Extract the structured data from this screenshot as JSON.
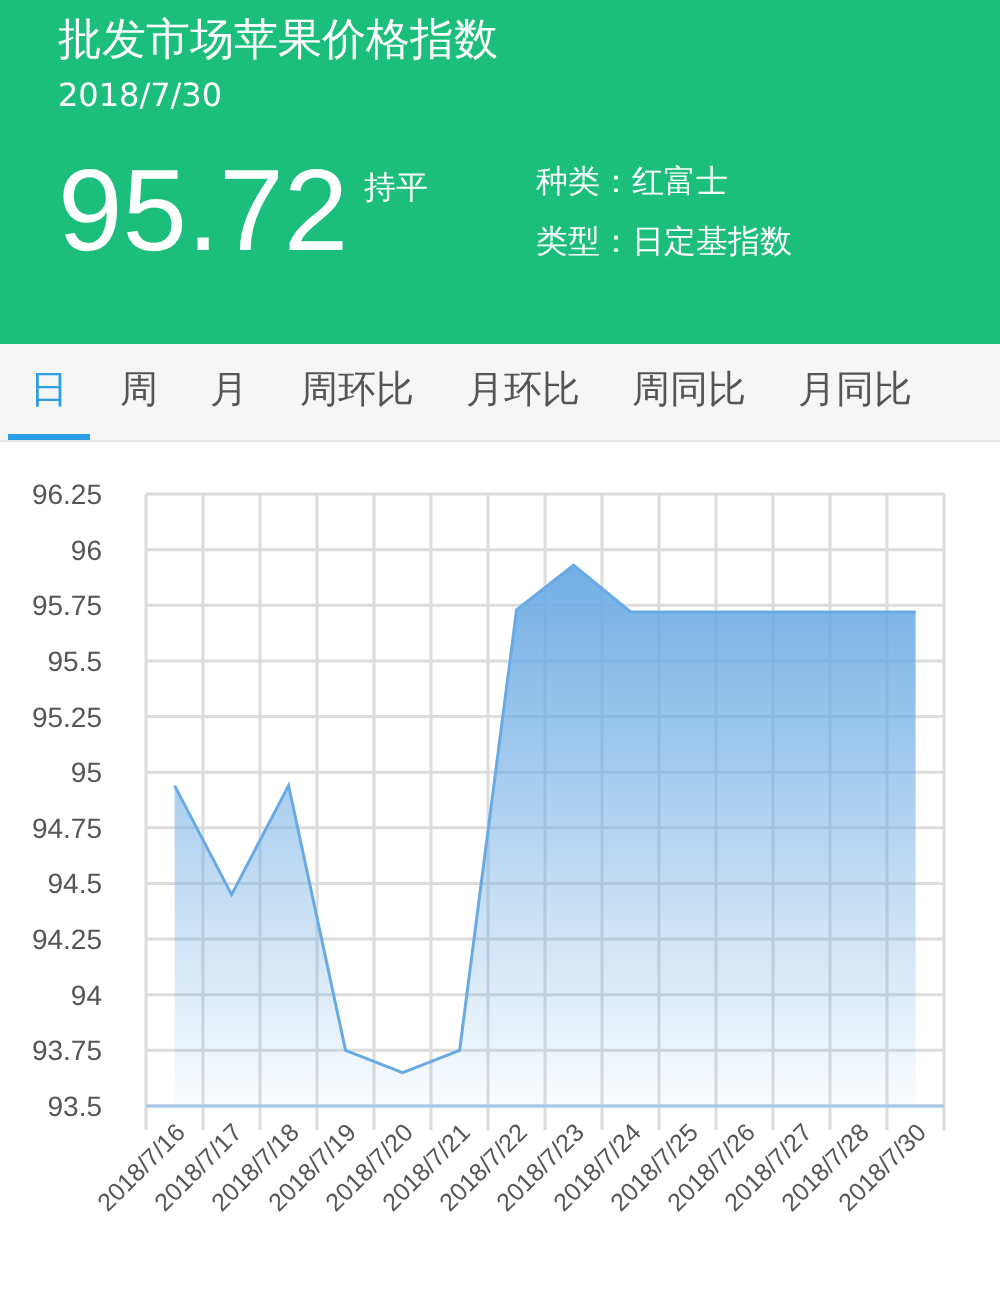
{
  "header": {
    "title": "批发市场苹果价格指数",
    "date": "2018/7/30",
    "value": "95.72",
    "trend": "持平",
    "info": [
      {
        "label": "种类：",
        "value": "红富士"
      },
      {
        "label": "类型：",
        "value": "日定基指数"
      }
    ]
  },
  "tabs": [
    {
      "label": "日",
      "selected": true
    },
    {
      "label": "周",
      "selected": false
    },
    {
      "label": "月",
      "selected": false
    },
    {
      "label": "周环比",
      "selected": false
    },
    {
      "label": "月环比",
      "selected": false
    },
    {
      "label": "周同比",
      "selected": false
    },
    {
      "label": "月同比",
      "selected": false
    }
  ],
  "chart": {
    "chart_data": {
      "type": "area",
      "categories": [
        "2018/7/16",
        "2018/7/17",
        "2018/7/18",
        "2018/7/19",
        "2018/7/20",
        "2018/7/21",
        "2018/7/22",
        "2018/7/23",
        "2018/7/24",
        "2018/7/25",
        "2018/7/26",
        "2018/7/27",
        "2018/7/28",
        "2018/7/30"
      ],
      "grid": true,
      "series": [
        {
          "color": "#6aaae4",
          "values": [
            94.94,
            94.45,
            94.94,
            93.75,
            93.65,
            93.75,
            95.73,
            95.93,
            95.72,
            95.72,
            95.72,
            95.72,
            95.72,
            95.72
          ]
        }
      ],
      "ylim": [
        93.5,
        96.25
      ],
      "yticks": [
        96.25,
        96,
        95.75,
        95.5,
        95.25,
        95,
        94.75,
        94.5,
        94.25,
        94,
        93.75,
        93.5
      ]
    }
  }
}
